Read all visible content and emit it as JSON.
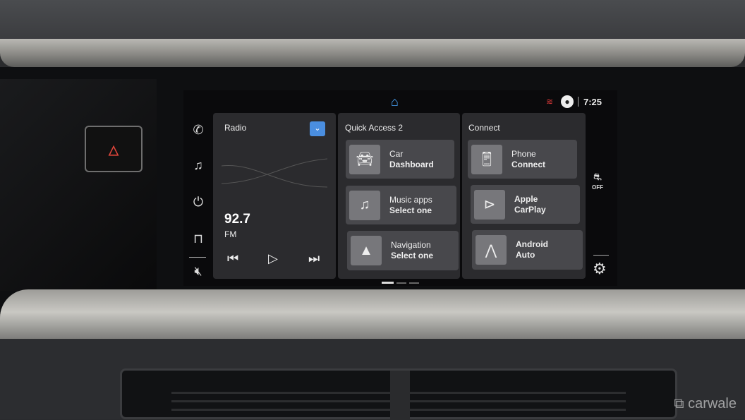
{
  "topbar": {
    "time": "7:25",
    "home_icon": "home-icon",
    "wifi_icon": "wifi-off-icon",
    "profile_icon": "user-icon"
  },
  "rail_left": [
    "phone-icon",
    "music-icon",
    "power-icon",
    "shopping-bag-icon",
    "mute-icon"
  ],
  "radio": {
    "title": "Radio",
    "frequency": "92.7",
    "band": "FM",
    "accent": "#4a8ee0"
  },
  "quick_access": {
    "title": "Quick Access 2",
    "tiles": [
      {
        "line1": "Car",
        "line2": "Dashboard",
        "icon": "car-icon"
      },
      {
        "line1": "Music apps",
        "line2": "Select one",
        "icon": "music-icon"
      },
      {
        "line1": "Navigation",
        "line2": "Select one",
        "icon": "navigation-arrow-icon"
      }
    ]
  },
  "connect": {
    "title": "Connect",
    "tiles": [
      {
        "line1": "Phone",
        "line2": "Connect",
        "icon": "phone-add-icon"
      },
      {
        "line1": "Apple",
        "line2": "CarPlay",
        "icon": "carplay-icon"
      },
      {
        "line1": "Android",
        "line2": "Auto",
        "icon": "android-auto-icon"
      }
    ]
  },
  "rail_right": {
    "esc_label": "OFF",
    "settings_icon": "gear-icon"
  },
  "pagination": {
    "pages": 3,
    "current": 1
  },
  "watermark": "carwale"
}
